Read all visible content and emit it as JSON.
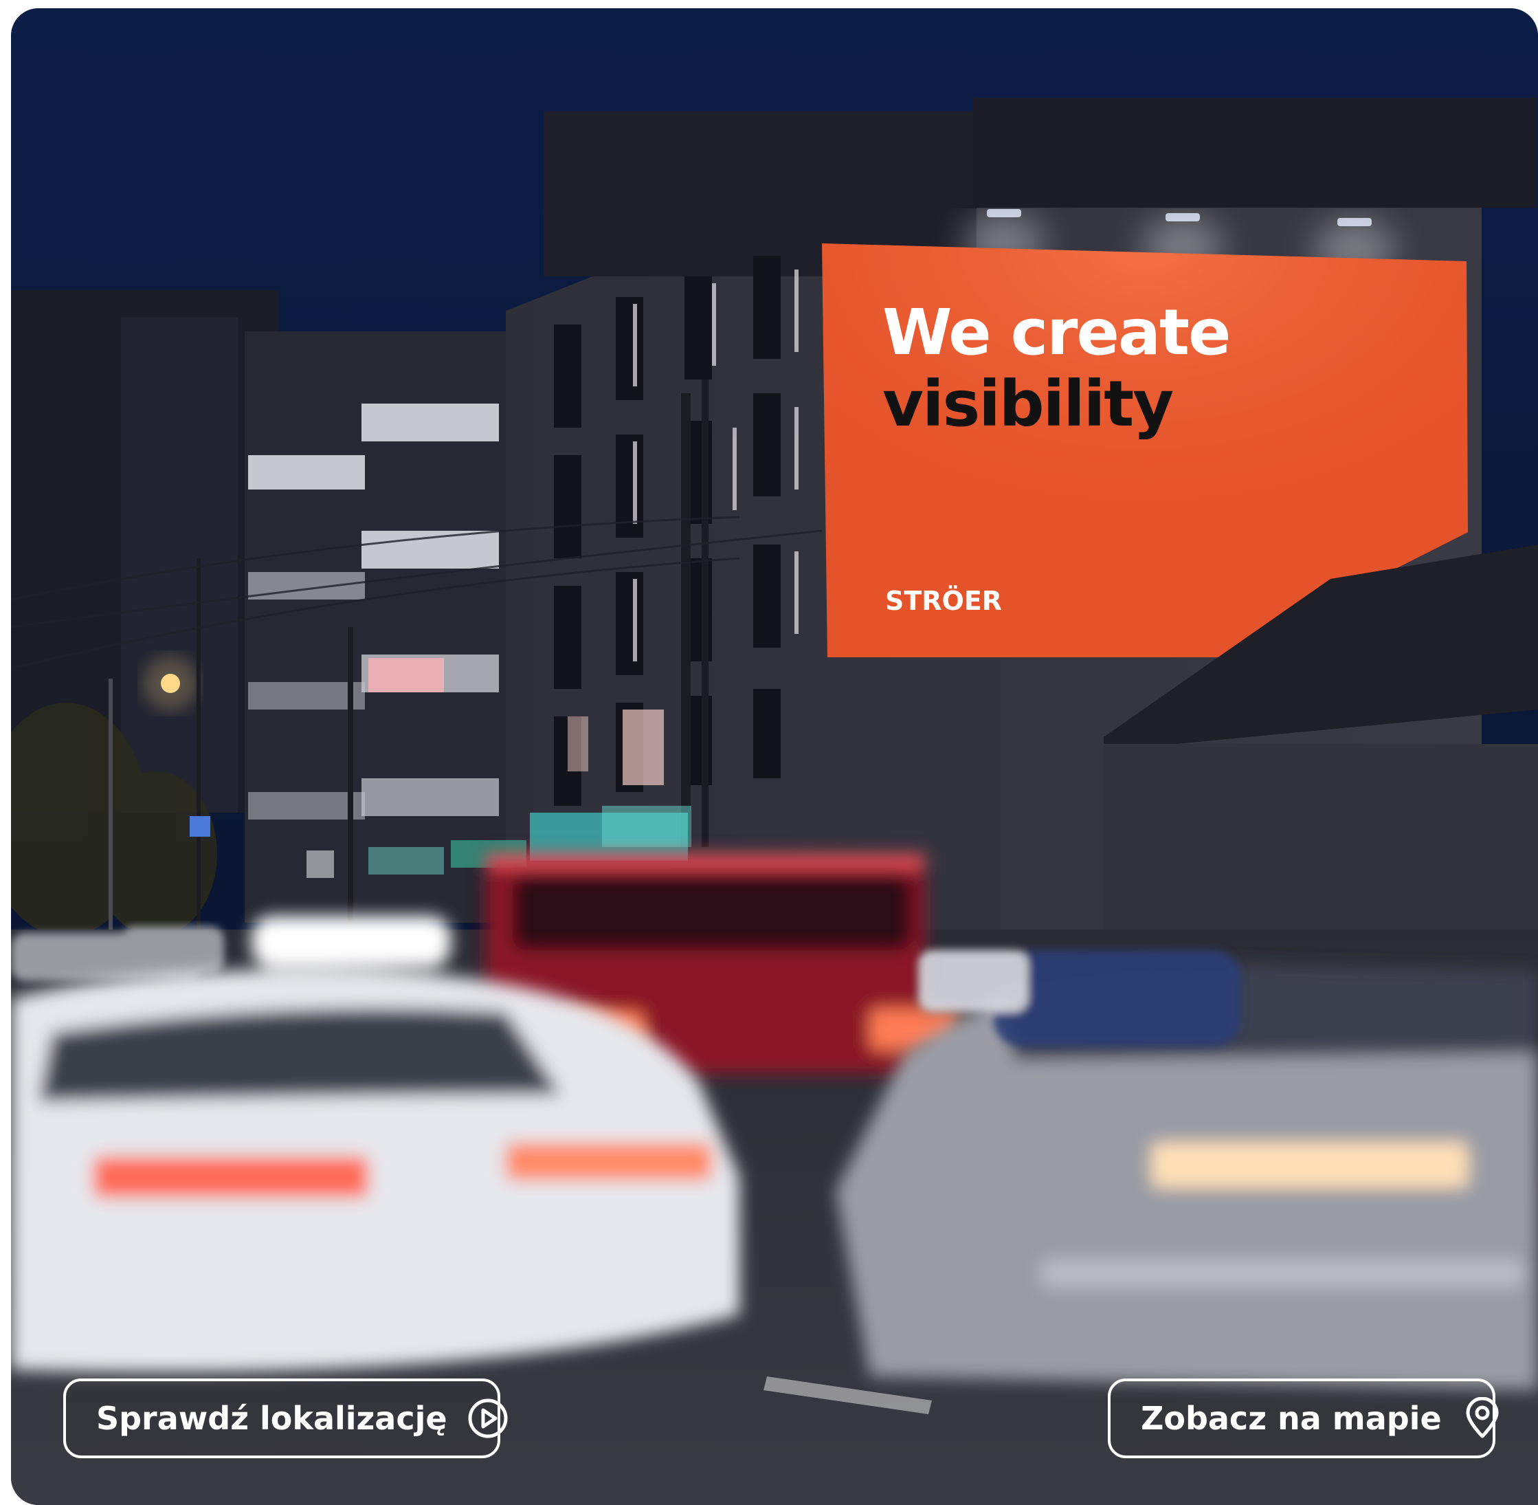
{
  "billboard": {
    "headline_line1": "We create",
    "headline_line2": "visibility",
    "brand": "STRÖER",
    "color": "#e5532a"
  },
  "actions": {
    "check_location": {
      "label": "Sprawdź lokalizację",
      "icon": "play-circle-icon"
    },
    "view_on_map": {
      "label": "Zobacz na mapie",
      "icon": "map-pin-icon"
    }
  }
}
